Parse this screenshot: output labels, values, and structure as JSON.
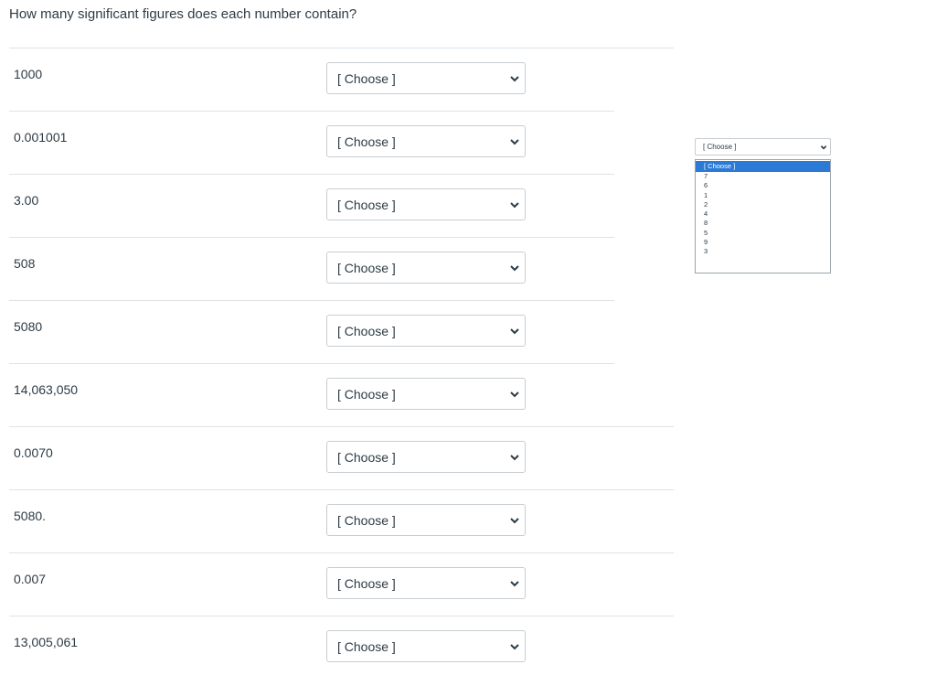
{
  "question": "How many significant figures does each number contain?",
  "placeholder": "[ Choose ]",
  "rows": [
    {
      "label": "1000",
      "value": "[ Choose ]"
    },
    {
      "label": "0.001001",
      "value": "[ Choose ]"
    },
    {
      "label": "3.00",
      "value": "[ Choose ]"
    },
    {
      "label": "508",
      "value": "[ Choose ]"
    },
    {
      "label": "5080",
      "value": "[ Choose ]"
    },
    {
      "label": "14,063,050",
      "value": "[ Choose ]"
    },
    {
      "label": "0.0070",
      "value": "[ Choose ]"
    },
    {
      "label": "5080.",
      "value": "[ Choose ]"
    },
    {
      "label": "0.007",
      "value": "[ Choose ]"
    },
    {
      "label": "13,005,061",
      "value": "[ Choose ]"
    }
  ],
  "dropdown_popup": {
    "current": "[ Choose ]",
    "options": [
      "[ Choose ]",
      "7",
      "6",
      "1",
      "2",
      "4",
      "8",
      "5",
      "9",
      "3"
    ],
    "highlighted_index": 0
  },
  "colors": {
    "text": "#2d3b45",
    "divider": "#dfe2e5",
    "border": "#c7cdd1",
    "highlight": "#2b7ad6"
  },
  "icons": {
    "select_arrow": "chevron-down-icon"
  }
}
